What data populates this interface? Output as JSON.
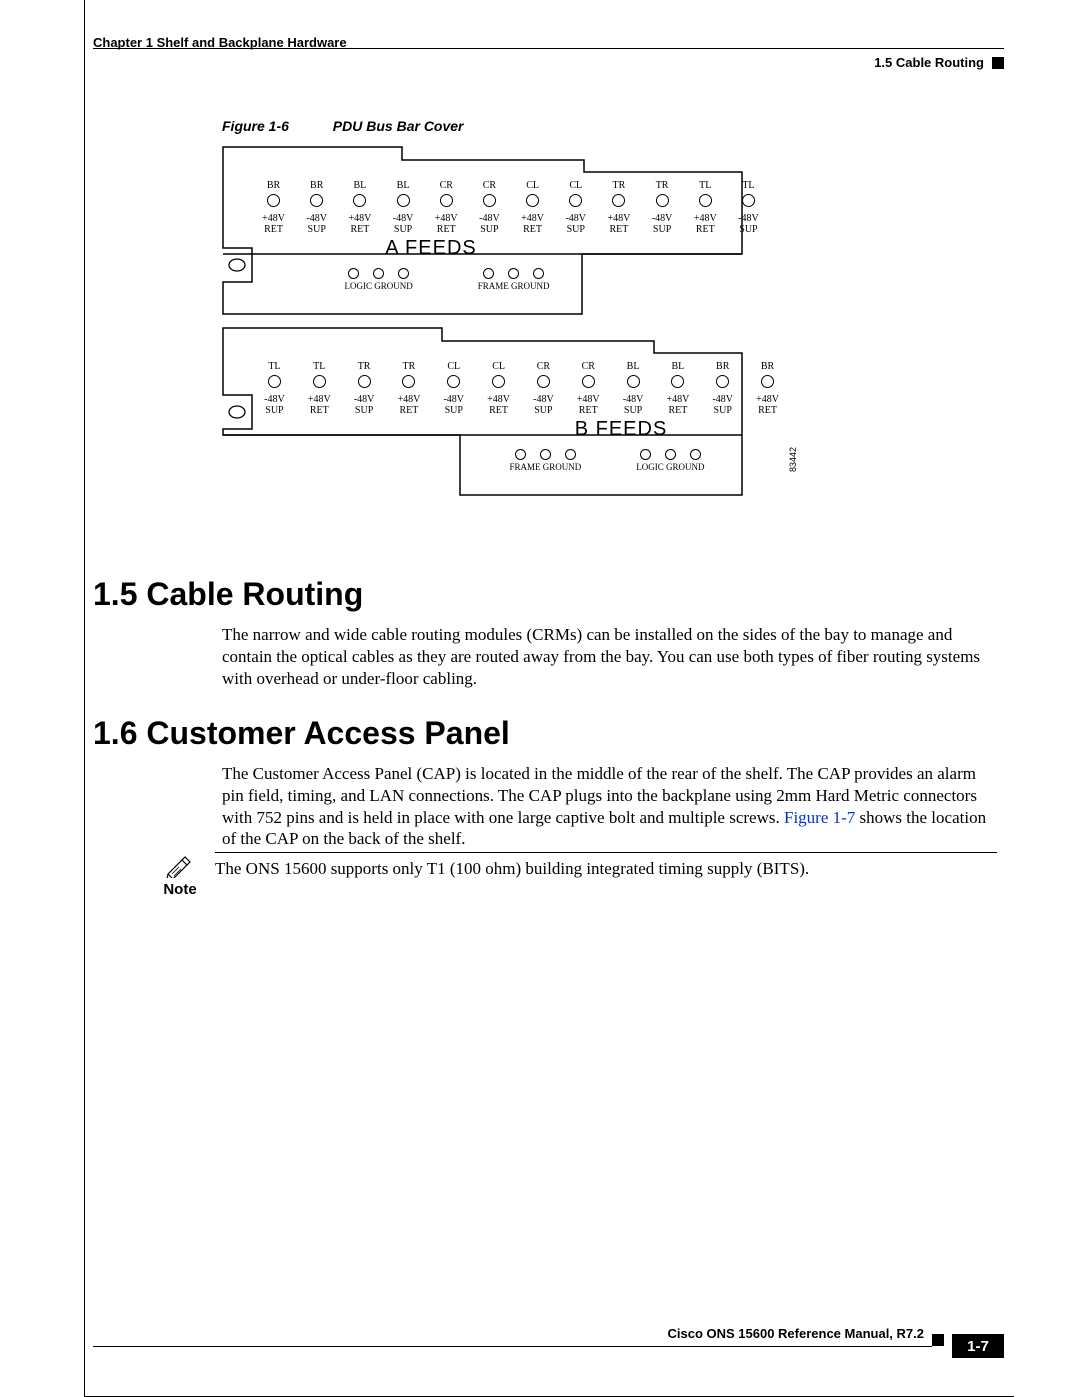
{
  "header": {
    "chapter": "Chapter 1    Shelf and Backplane Hardware",
    "section": "1.5  Cable Routing"
  },
  "figure": {
    "label": "Figure 1-6",
    "title": "PDU Bus Bar Cover",
    "id": "83442",
    "panelA": {
      "feed_title": "A FEEDS",
      "terminals": [
        {
          "top": "BR",
          "bot1": "+48V",
          "bot2": "RET"
        },
        {
          "top": "BR",
          "bot1": "-48V",
          "bot2": "SUP"
        },
        {
          "top": "BL",
          "bot1": "+48V",
          "bot2": "RET"
        },
        {
          "top": "BL",
          "bot1": "-48V",
          "bot2": "SUP"
        },
        {
          "top": "CR",
          "bot1": "+48V",
          "bot2": "RET"
        },
        {
          "top": "CR",
          "bot1": "-48V",
          "bot2": "SUP"
        },
        {
          "top": "CL",
          "bot1": "+48V",
          "bot2": "RET"
        },
        {
          "top": "CL",
          "bot1": "-48V",
          "bot2": "SUP"
        },
        {
          "top": "TR",
          "bot1": "+48V",
          "bot2": "RET"
        },
        {
          "top": "TR",
          "bot1": "-48V",
          "bot2": "SUP"
        },
        {
          "top": "TL",
          "bot1": "+48V",
          "bot2": "RET"
        },
        {
          "top": "TL",
          "bot1": "-48V",
          "bot2": "SUP"
        }
      ],
      "ground": [
        {
          "label": "LOGIC GROUND",
          "holes": 3
        },
        {
          "label": "FRAME GROUND",
          "holes": 3
        }
      ]
    },
    "panelB": {
      "feed_title": "B FEEDS",
      "terminals": [
        {
          "top": "TL",
          "bot1": "-48V",
          "bot2": "SUP"
        },
        {
          "top": "TL",
          "bot1": "+48V",
          "bot2": "RET"
        },
        {
          "top": "TR",
          "bot1": "-48V",
          "bot2": "SUP"
        },
        {
          "top": "TR",
          "bot1": "+48V",
          "bot2": "RET"
        },
        {
          "top": "CL",
          "bot1": "-48V",
          "bot2": "SUP"
        },
        {
          "top": "CL",
          "bot1": "+48V",
          "bot2": "RET"
        },
        {
          "top": "CR",
          "bot1": "-48V",
          "bot2": "SUP"
        },
        {
          "top": "CR",
          "bot1": "+48V",
          "bot2": "RET"
        },
        {
          "top": "BL",
          "bot1": "-48V",
          "bot2": "SUP"
        },
        {
          "top": "BL",
          "bot1": "+48V",
          "bot2": "RET"
        },
        {
          "top": "BR",
          "bot1": "-48V",
          "bot2": "SUP"
        },
        {
          "top": "BR",
          "bot1": "+48V",
          "bot2": "RET"
        }
      ],
      "ground": [
        {
          "label": "FRAME GROUND",
          "holes": 3
        },
        {
          "label": "LOGIC GROUND",
          "holes": 3
        }
      ]
    }
  },
  "sections": {
    "s15": {
      "heading": "1.5  Cable Routing",
      "body": "The narrow and wide cable routing modules (CRMs) can be installed on the sides of the bay to manage and contain the optical cables as they are routed away from the bay. You can use both types of fiber routing systems with overhead or under-floor cabling."
    },
    "s16": {
      "heading": "1.6  Customer Access Panel",
      "body1": "The Customer Access Panel (CAP) is located in the middle of the rear of the shelf. The CAP provides an alarm pin field, timing, and LAN connections. The CAP plugs into the backplane using 2mm Hard Metric connectors with 752 pins and is held in place with one large captive bolt and multiple screws. ",
      "link": "Figure 1-7",
      "body2": " shows the location of the CAP on the back of the shelf."
    }
  },
  "note": {
    "label": "Note",
    "text": "The ONS 15600 supports only T1 (100 ohm) building integrated timing supply (BITS)."
  },
  "footer": {
    "manual": "Cisco ONS 15600 Reference Manual, R7.2",
    "page": "1-7"
  }
}
